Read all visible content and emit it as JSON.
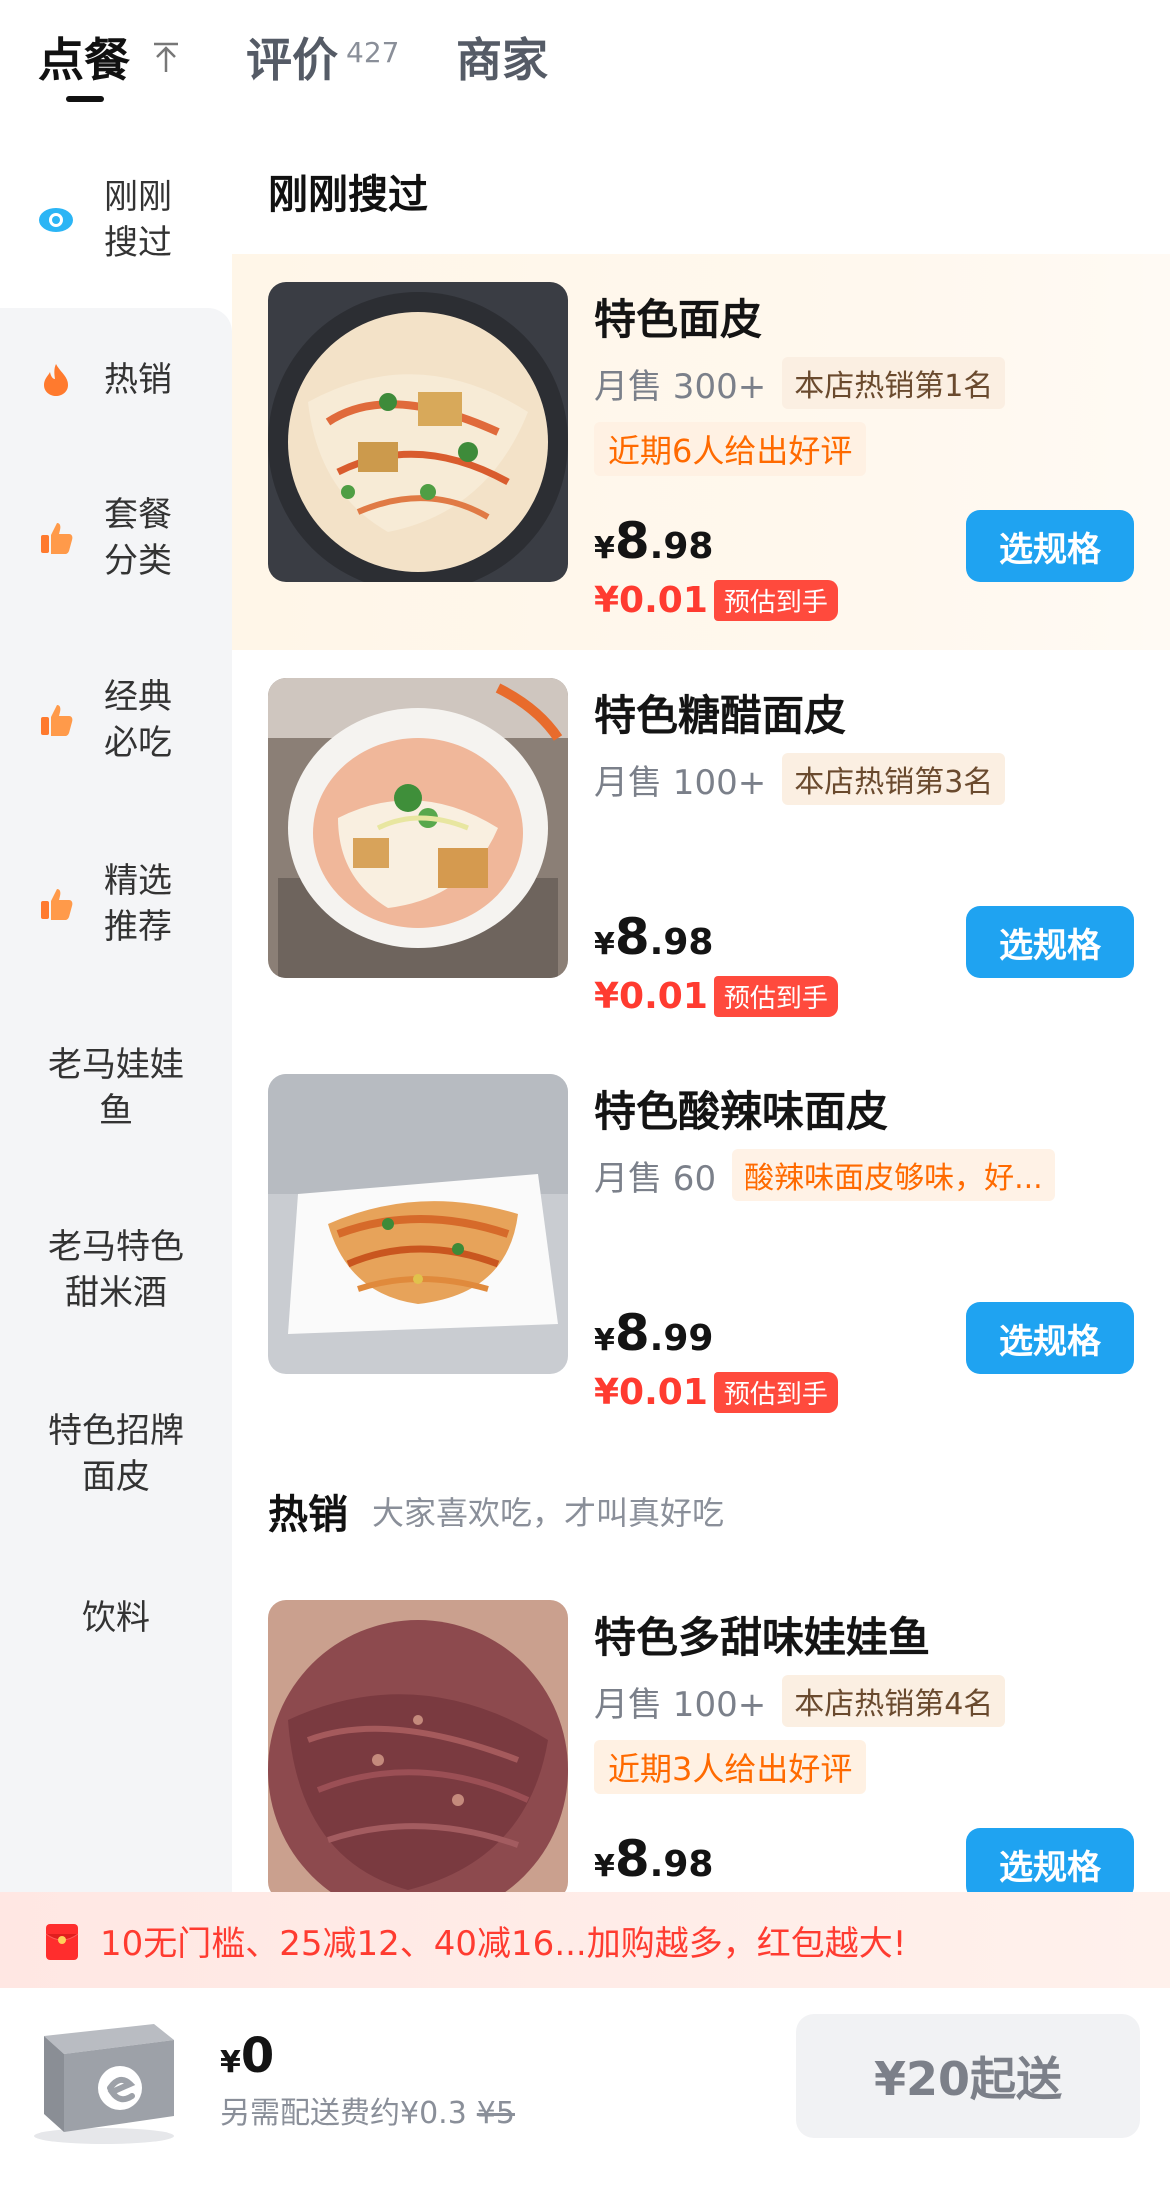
{
  "tabs": {
    "order": "点餐",
    "review": "评价",
    "review_count": "427",
    "merchant": "商家"
  },
  "sidebar": {
    "items": [
      {
        "label": "刚刚\n搜过",
        "icon": "eye-icon"
      },
      {
        "label": "热销",
        "icon": "flame-icon"
      },
      {
        "label": "套餐\n分类",
        "icon": "thumb-icon"
      },
      {
        "label": "经典\n必吃",
        "icon": "thumb-icon"
      },
      {
        "label": "精选\n推荐",
        "icon": "thumb-icon"
      },
      {
        "label": "老马娃娃\n鱼"
      },
      {
        "label": "老马特色\n甜米酒"
      },
      {
        "label": "特色招牌\n面皮"
      },
      {
        "label": "饮料"
      }
    ]
  },
  "sections": {
    "recent_title": "刚刚搜过",
    "hot_title": "热销",
    "hot_subtitle": "大家喜欢吃，才叫真好吃"
  },
  "items": [
    {
      "name": "特色面皮",
      "sales": "月售 300+",
      "tag": "本店热销第1名",
      "good": "近期6人给出好评",
      "price_int": "8",
      "price_dec": ".98",
      "deal": "¥0.01",
      "deal_tag": "预估到手",
      "button": "选规格"
    },
    {
      "name": "特色糖醋面皮",
      "sales": "月售 100+",
      "tag": "本店热销第3名",
      "price_int": "8",
      "price_dec": ".98",
      "deal": "¥0.01",
      "deal_tag": "预估到手",
      "button": "选规格"
    },
    {
      "name": "特色酸辣味面皮",
      "sales": "月售 60",
      "tag": "酸辣味面皮够味，好...",
      "price_int": "8",
      "price_dec": ".99",
      "deal": "¥0.01",
      "deal_tag": "预估到手",
      "button": "选规格"
    },
    {
      "name": "特色多甜味娃娃鱼",
      "sales": "月售 100+",
      "tag": "本店热销第4名",
      "good": "近期3人给出好评",
      "price_int": "8",
      "price_dec": ".98",
      "button": "选规格"
    }
  ],
  "currency": "¥",
  "promo": {
    "text": "10无门槛、25减12、40减16...加购越多，红包越大!",
    "icon": "red-envelope-icon"
  },
  "cart": {
    "total": "0",
    "delivery_note": "另需配送费约¥0.3",
    "delivery_original": "¥5",
    "checkout_label": "¥20起送",
    "icon": "cart-box-icon"
  },
  "colors": {
    "accent_blue": "#1fa3f1",
    "deal_red": "#ff3b30",
    "tag_orange": "#ff6a00",
    "highlight_bg": "#fff6e8"
  }
}
